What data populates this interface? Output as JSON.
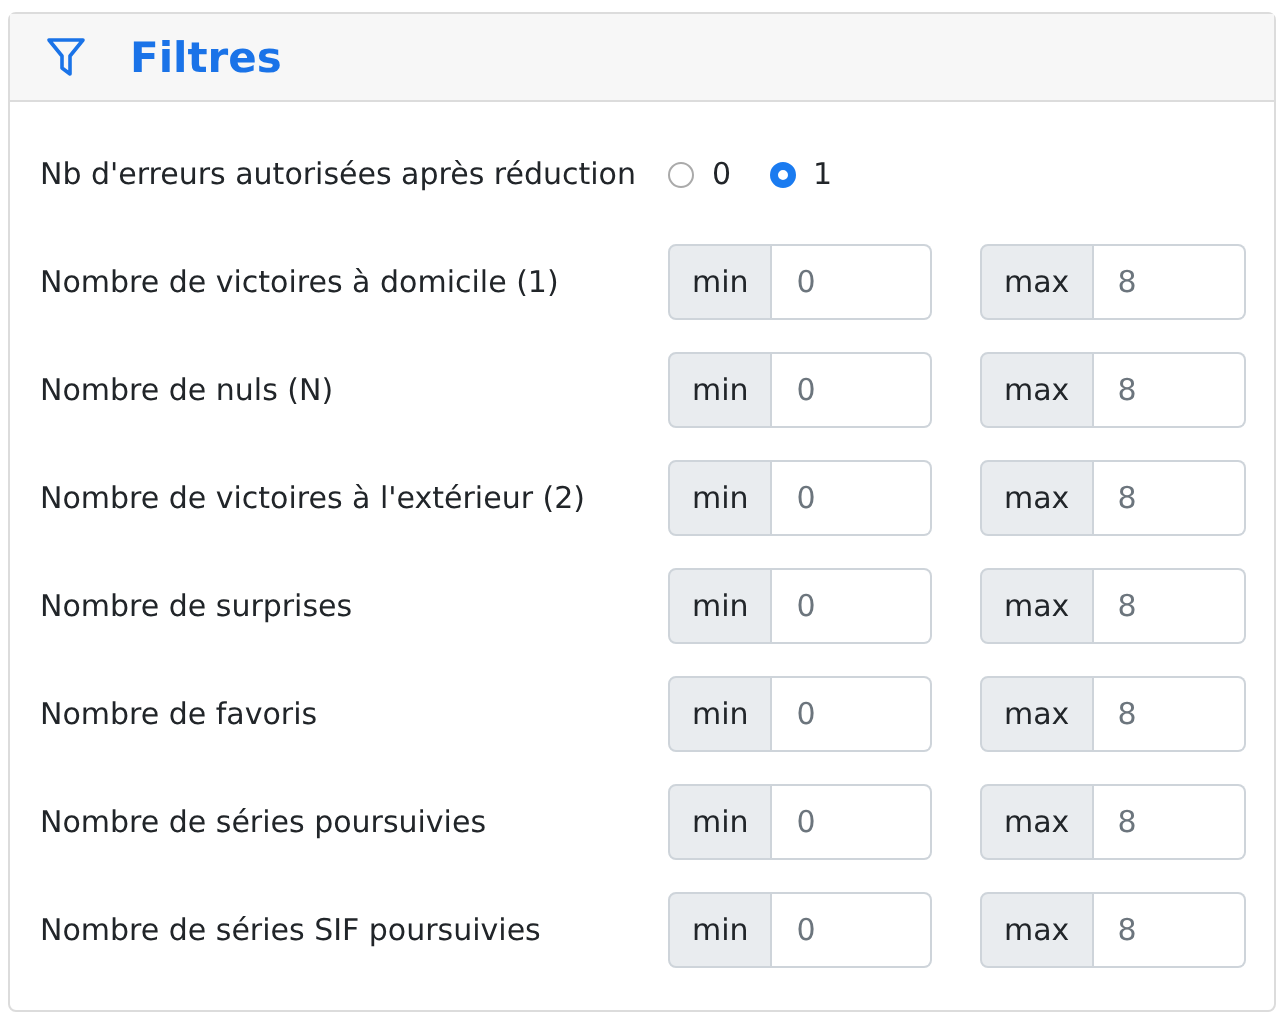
{
  "card": {
    "title": "Filtres"
  },
  "errors": {
    "label": "Nb d'erreurs autorisées après réduction",
    "options": [
      {
        "label": "0",
        "selected": false
      },
      {
        "label": "1",
        "selected": true
      }
    ]
  },
  "ranges": [
    {
      "label": "Nombre de victoires à domicile (1)",
      "min_label": "min",
      "min": "0",
      "max_label": "max",
      "max": "8"
    },
    {
      "label": "Nombre de nuls (N)",
      "min_label": "min",
      "min": "0",
      "max_label": "max",
      "max": "8"
    },
    {
      "label": "Nombre de victoires à l'extérieur (2)",
      "min_label": "min",
      "min": "0",
      "max_label": "max",
      "max": "8"
    },
    {
      "label": "Nombre de surprises",
      "min_label": "min",
      "min": "0",
      "max_label": "max",
      "max": "8"
    },
    {
      "label": "Nombre de favoris",
      "min_label": "min",
      "min": "0",
      "max_label": "max",
      "max": "8"
    },
    {
      "label": "Nombre de séries poursuivies",
      "min_label": "min",
      "min": "0",
      "max_label": "max",
      "max": "8"
    },
    {
      "label": "Nombre de séries SIF poursuivies",
      "min_label": "min",
      "min": "0",
      "max_label": "max",
      "max": "8"
    }
  ]
}
